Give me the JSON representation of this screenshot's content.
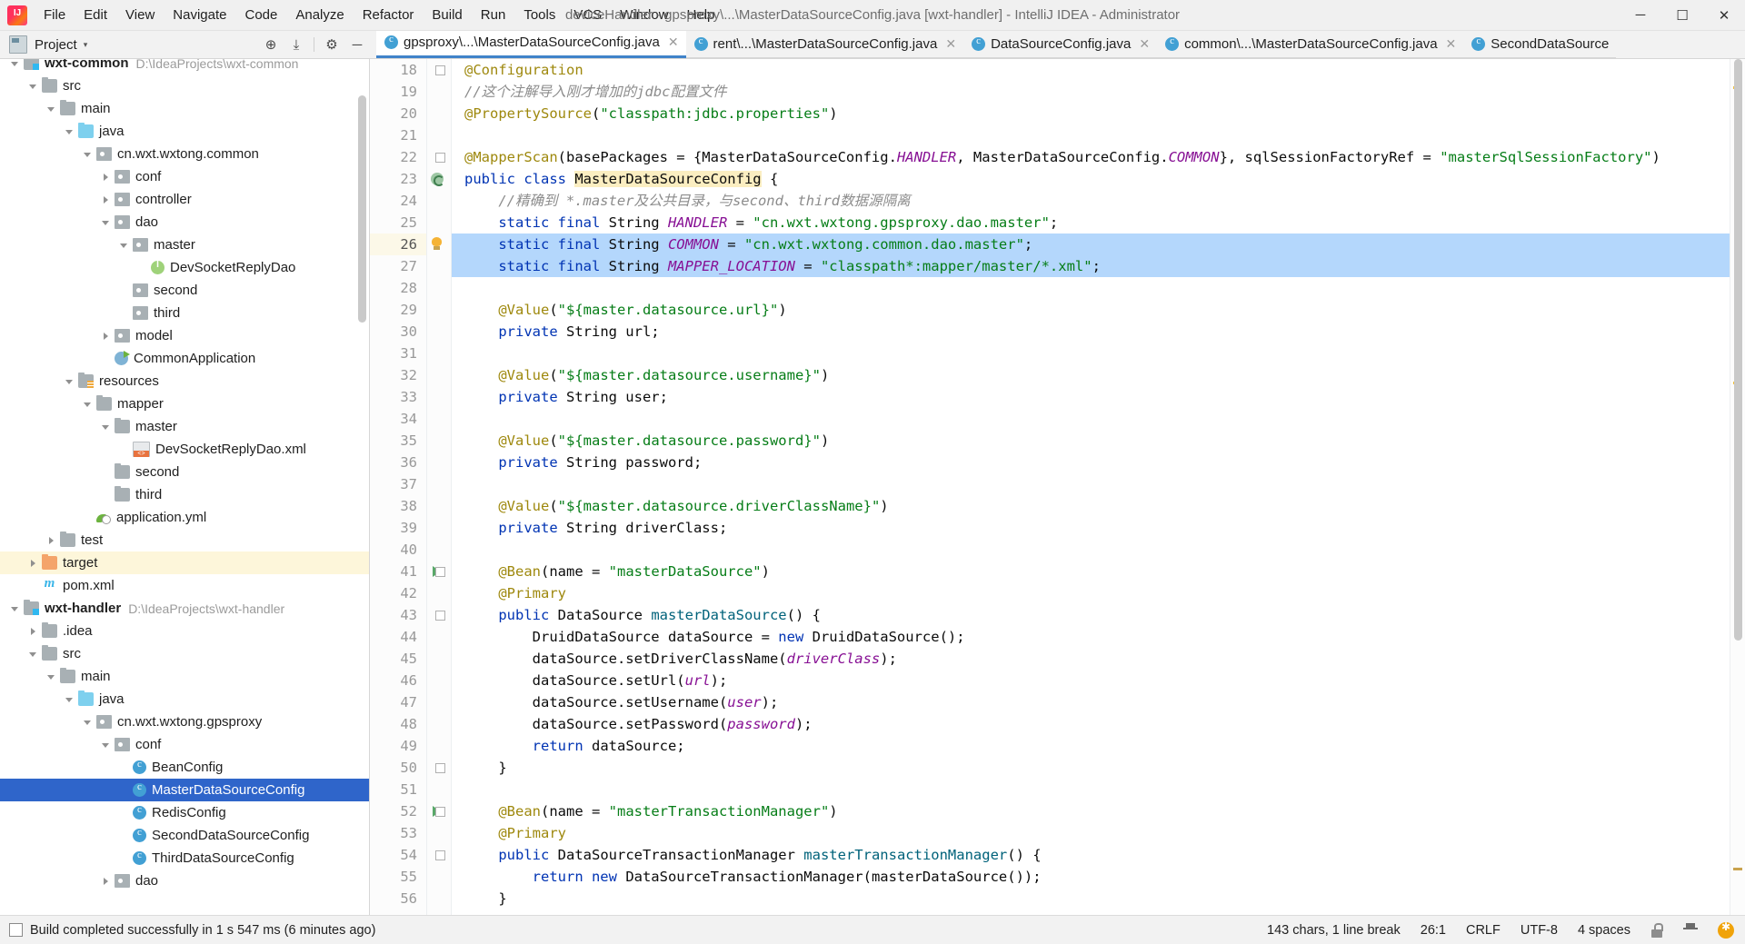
{
  "window": {
    "title": "deviceHandler - gpsproxy\\...\\MasterDataSourceConfig.java [wxt-handler] - IntelliJ IDEA - Administrator",
    "minimize": "─",
    "maximize": "☐",
    "close": "✕"
  },
  "menu": [
    {
      "label": "File"
    },
    {
      "label": "Edit"
    },
    {
      "label": "View"
    },
    {
      "label": "Navigate"
    },
    {
      "label": "Code"
    },
    {
      "label": "Analyze"
    },
    {
      "label": "Refactor"
    },
    {
      "label": "Build"
    },
    {
      "label": "Run"
    },
    {
      "label": "Tools"
    },
    {
      "label": "VCS"
    },
    {
      "label": "Window"
    },
    {
      "label": "Help"
    }
  ],
  "toolbar": {
    "project_label": "Project",
    "caret": "▾",
    "locate_icon": "⊕",
    "collapse_icon": "⤓",
    "settings_icon": "⚙",
    "hide_icon": "─"
  },
  "tabs": [
    {
      "label": "gpsproxy\\...\\MasterDataSourceConfig.java",
      "active": true,
      "close": "✕"
    },
    {
      "label": "rent\\...\\MasterDataSourceConfig.java",
      "active": false,
      "close": "✕"
    },
    {
      "label": "DataSourceConfig.java",
      "active": false,
      "close": "✕"
    },
    {
      "label": "common\\...\\MasterDataSourceConfig.java",
      "active": false,
      "close": "✕"
    },
    {
      "label": "SecondDataSource",
      "active": false,
      "close": "✕"
    }
  ],
  "tree": [
    {
      "indent": 0,
      "arrow": "down",
      "icon": "module",
      "label": "wxt-common",
      "bold": true,
      "path": "D:\\IdeaProjects\\wxt-common"
    },
    {
      "indent": 1,
      "arrow": "down",
      "icon": "folder",
      "label": "src"
    },
    {
      "indent": 2,
      "arrow": "down",
      "icon": "folder",
      "label": "main"
    },
    {
      "indent": 3,
      "arrow": "down",
      "icon": "source",
      "label": "java"
    },
    {
      "indent": 4,
      "arrow": "down",
      "icon": "package",
      "label": "cn.wxt.wxtong.common"
    },
    {
      "indent": 5,
      "arrow": "right",
      "icon": "package",
      "label": "conf"
    },
    {
      "indent": 5,
      "arrow": "right",
      "icon": "package",
      "label": "controller"
    },
    {
      "indent": 5,
      "arrow": "down",
      "icon": "package",
      "label": "dao"
    },
    {
      "indent": 6,
      "arrow": "down",
      "icon": "package",
      "label": "master"
    },
    {
      "indent": 7,
      "arrow": "none",
      "icon": "interface",
      "label": "DevSocketReplyDao"
    },
    {
      "indent": 6,
      "arrow": "none",
      "icon": "package",
      "label": "second"
    },
    {
      "indent": 6,
      "arrow": "none",
      "icon": "package",
      "label": "third"
    },
    {
      "indent": 5,
      "arrow": "right",
      "icon": "package",
      "label": "model"
    },
    {
      "indent": 5,
      "arrow": "none",
      "icon": "springapp",
      "label": "CommonApplication"
    },
    {
      "indent": 3,
      "arrow": "down",
      "icon": "resources",
      "label": "resources"
    },
    {
      "indent": 4,
      "arrow": "down",
      "icon": "folder",
      "label": "mapper"
    },
    {
      "indent": 5,
      "arrow": "down",
      "icon": "folder",
      "label": "master"
    },
    {
      "indent": 6,
      "arrow": "none",
      "icon": "xml",
      "label": "DevSocketReplyDao.xml"
    },
    {
      "indent": 5,
      "arrow": "none",
      "icon": "folder",
      "label": "second"
    },
    {
      "indent": 5,
      "arrow": "none",
      "icon": "folder",
      "label": "third"
    },
    {
      "indent": 4,
      "arrow": "none",
      "icon": "yml",
      "label": "application.yml"
    },
    {
      "indent": 2,
      "arrow": "right",
      "icon": "folder",
      "label": "test"
    },
    {
      "indent": 1,
      "arrow": "right",
      "icon": "folder-orange",
      "label": "target",
      "highlight": true
    },
    {
      "indent": 1,
      "arrow": "none",
      "icon": "maven",
      "label": "pom.xml"
    },
    {
      "indent": 0,
      "arrow": "down",
      "icon": "module",
      "label": "wxt-handler",
      "bold": true,
      "path": "D:\\IdeaProjects\\wxt-handler"
    },
    {
      "indent": 1,
      "arrow": "right",
      "icon": "folder",
      "label": ".idea"
    },
    {
      "indent": 1,
      "arrow": "down",
      "icon": "folder",
      "label": "src"
    },
    {
      "indent": 2,
      "arrow": "down",
      "icon": "folder",
      "label": "main"
    },
    {
      "indent": 3,
      "arrow": "down",
      "icon": "source",
      "label": "java"
    },
    {
      "indent": 4,
      "arrow": "down",
      "icon": "package",
      "label": "cn.wxt.wxtong.gpsproxy"
    },
    {
      "indent": 5,
      "arrow": "down",
      "icon": "package",
      "label": "conf"
    },
    {
      "indent": 6,
      "arrow": "none",
      "icon": "class",
      "label": "BeanConfig"
    },
    {
      "indent": 6,
      "arrow": "none",
      "icon": "class",
      "label": "MasterDataSourceConfig",
      "selected": true
    },
    {
      "indent": 6,
      "arrow": "none",
      "icon": "class",
      "label": "RedisConfig"
    },
    {
      "indent": 6,
      "arrow": "none",
      "icon": "class",
      "label": "SecondDataSourceConfig"
    },
    {
      "indent": 6,
      "arrow": "none",
      "icon": "class",
      "label": "ThirdDataSourceConfig"
    },
    {
      "indent": 5,
      "arrow": "right",
      "icon": "package",
      "label": "dao"
    }
  ],
  "editor": {
    "first_line": 18,
    "lines": [
      {
        "n": 18,
        "fold": true,
        "html": "<span class=\"an\">@Configuration</span>"
      },
      {
        "n": 19,
        "html": "<span class=\"cm\">//这个注解导入刚才增加的jdbc配置文件</span>"
      },
      {
        "n": 20,
        "html": "<span class=\"an\">@PropertySource</span>(<span class=\"st\">\"classpath:jdbc.properties\"</span>)"
      },
      {
        "n": 21,
        "html": ""
      },
      {
        "n": 22,
        "fold": true,
        "html": "<span class=\"an\">@MapperScan</span>(basePackages = {MasterDataSourceConfig.<span class=\"fld\">HANDLER</span>, MasterDataSourceConfig.<span class=\"fld\">COMMON</span>}, sqlSessionFactoryRef = <span class=\"st\">\"masterSqlSessionFactory\"</span>)"
      },
      {
        "n": 23,
        "spring": true,
        "html": "<span class=\"k\">public class</span> <span class=\"hlname\">MasterDataSourceConfig</span> {"
      },
      {
        "n": 24,
        "html": "    <span class=\"cm\">//精确到 *.master及公共目录，与second、third数据源隔离</span>"
      },
      {
        "n": 25,
        "html": "    <span class=\"k\">static final</span> String <span class=\"fld\">HANDLER</span> = <span class=\"st\">\"cn.wxt.wxtong.gpsproxy.dao.master\"</span>;"
      },
      {
        "n": 26,
        "bulb": true,
        "current": true,
        "highlight": true,
        "html": "    <span class=\"k\">static final</span> String <span class=\"fld\">COMMON</span> = <span class=\"st\">\"cn.wxt.wxtong.common.dao.master\"</span>;"
      },
      {
        "n": 27,
        "highlight": true,
        "html": "    <span class=\"k\">static final</span> String <span class=\"fld\">MAPPER_LOCATION</span> = <span class=\"st\">\"classpath*:mapper/master/*.xml\"</span>;"
      },
      {
        "n": 28,
        "html": ""
      },
      {
        "n": 29,
        "html": "    <span class=\"an\">@Value</span>(<span class=\"st\">\"${master.datasource.url}\"</span>)"
      },
      {
        "n": 30,
        "html": "    <span class=\"k\">private</span> String url;"
      },
      {
        "n": 31,
        "html": ""
      },
      {
        "n": 32,
        "html": "    <span class=\"an\">@Value</span>(<span class=\"st\">\"${master.datasource.username}\"</span>)"
      },
      {
        "n": 33,
        "html": "    <span class=\"k\">private</span> String user;"
      },
      {
        "n": 34,
        "html": ""
      },
      {
        "n": 35,
        "html": "    <span class=\"an\">@Value</span>(<span class=\"st\">\"${master.datasource.password}\"</span>)"
      },
      {
        "n": 36,
        "html": "    <span class=\"k\">private</span> String password;"
      },
      {
        "n": 37,
        "html": ""
      },
      {
        "n": 38,
        "html": "    <span class=\"an\">@Value</span>(<span class=\"st\">\"${master.datasource.driverClassName}\"</span>)"
      },
      {
        "n": 39,
        "html": "    <span class=\"k\">private</span> String driverClass;"
      },
      {
        "n": 40,
        "html": ""
      },
      {
        "n": 41,
        "run": true,
        "fold": true,
        "html": "    <span class=\"an\">@Bean</span>(name = <span class=\"st\">\"masterDataSource\"</span>)"
      },
      {
        "n": 42,
        "html": "    <span class=\"an\">@Primary</span>"
      },
      {
        "n": 43,
        "fold": true,
        "html": "    <span class=\"k\">public</span> DataSource <span class=\"mth\">masterDataSource</span>() {"
      },
      {
        "n": 44,
        "html": "        DruidDataSource dataSource = <span class=\"k\">new</span> DruidDataSource();"
      },
      {
        "n": 45,
        "html": "        dataSource.setDriverClassName(<span class=\"fld\">driverClass</span>);"
      },
      {
        "n": 46,
        "html": "        dataSource.setUrl(<span class=\"fld\">url</span>);"
      },
      {
        "n": 47,
        "html": "        dataSource.setUsername(<span class=\"fld\">user</span>);"
      },
      {
        "n": 48,
        "html": "        dataSource.setPassword(<span class=\"fld\">password</span>);"
      },
      {
        "n": 49,
        "html": "        <span class=\"k\">return</span> dataSource;"
      },
      {
        "n": 50,
        "fold": true,
        "html": "    }"
      },
      {
        "n": 51,
        "html": ""
      },
      {
        "n": 52,
        "run": true,
        "fold": true,
        "html": "    <span class=\"an\">@Bean</span>(name = <span class=\"st\">\"masterTransactionManager\"</span>)"
      },
      {
        "n": 53,
        "html": "    <span class=\"an\">@Primary</span>"
      },
      {
        "n": 54,
        "fold": true,
        "html": "    <span class=\"k\">public</span> DataSourceTransactionManager <span class=\"mth\">masterTransactionManager</span>() {"
      },
      {
        "n": 55,
        "html": "        <span class=\"k\">return new</span> DataSourceTransactionManager(masterDataSource());"
      },
      {
        "n": 56,
        "html": "    }"
      }
    ]
  },
  "status": {
    "build_message": "Build completed successfully in 1 s 547 ms (6 minutes ago)",
    "chars": "143 chars, 1 line break",
    "caret": "26:1",
    "line_separator": "CRLF",
    "encoding": "UTF-8",
    "indent": "4 spaces",
    "lock_icon": "lock-icon",
    "inspector_icon": "hector-icon",
    "notification_icon": "notification-icon"
  }
}
